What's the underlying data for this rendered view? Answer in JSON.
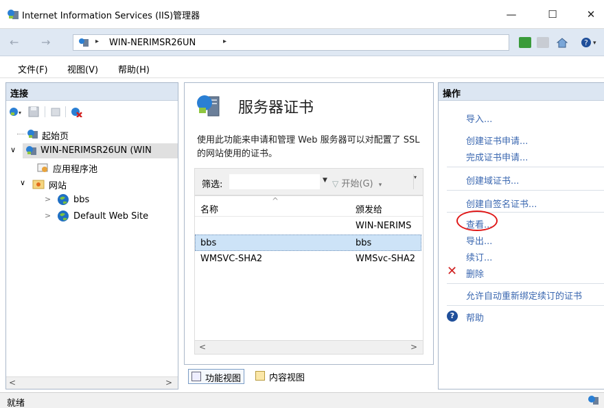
{
  "window": {
    "title": "Internet Information Services (IIS)管理器",
    "minimize": "—",
    "maximize": "☐",
    "close": "✕"
  },
  "address": {
    "breadcrumb": "WIN-NERIMSR26UN",
    "sep_char": "▸"
  },
  "menu": {
    "file": "文件(F)",
    "view": "视图(V)",
    "help": "帮助(H)"
  },
  "connections": {
    "title": "连接",
    "tree": [
      {
        "label": "起始页"
      },
      {
        "label": "WIN-NERIMSR26UN (WIN"
      },
      {
        "label": "应用程序池"
      },
      {
        "label": "网站"
      },
      {
        "label": "bbs"
      },
      {
        "label": "Default Web Site"
      }
    ]
  },
  "main": {
    "title": "服务器证书",
    "description": "使用此功能来申请和管理 Web 服务器可以对配置了 SSL 的网站使用的证书。",
    "filter_label": "筛选:",
    "filter_value": "",
    "go_label": "开始(G)",
    "columns": [
      "名称",
      "颁发给"
    ],
    "rows": [
      {
        "name": "",
        "issued_to": "WIN-NERIMS"
      },
      {
        "name": "bbs",
        "issued_to": "bbs"
      },
      {
        "name": "WMSVC-SHA2",
        "issued_to": "WMSvc-SHA2"
      }
    ],
    "selected_row": 1
  },
  "viewtabs": {
    "features": "功能视图",
    "content": "内容视图"
  },
  "actions": {
    "title": "操作",
    "import": "导入...",
    "create_request": "创建证书申请...",
    "complete_request": "完成证书申请...",
    "create_domain": "创建域证书...",
    "create_selfsigned": "创建自签名证书...",
    "view": "查看...",
    "export": "导出...",
    "renew": "续订...",
    "delete": "删除",
    "auto_rebind": "允许自动重新绑定续订的证书",
    "help": "帮助"
  },
  "status": {
    "text": "就绪"
  },
  "colors": {
    "link": "#3a67b0",
    "header_bg": "#dce6f2",
    "address_bg": "#dfe8f3",
    "annotation": "#e01818",
    "selected_row": "#cde3f7"
  },
  "icons": [
    "iis-server-icon",
    "back-icon",
    "forward-icon",
    "refresh-icon",
    "stop-icon",
    "home-icon",
    "help-icon",
    "globe-icon",
    "save-icon",
    "delete-icon",
    "certificate-icon"
  ]
}
